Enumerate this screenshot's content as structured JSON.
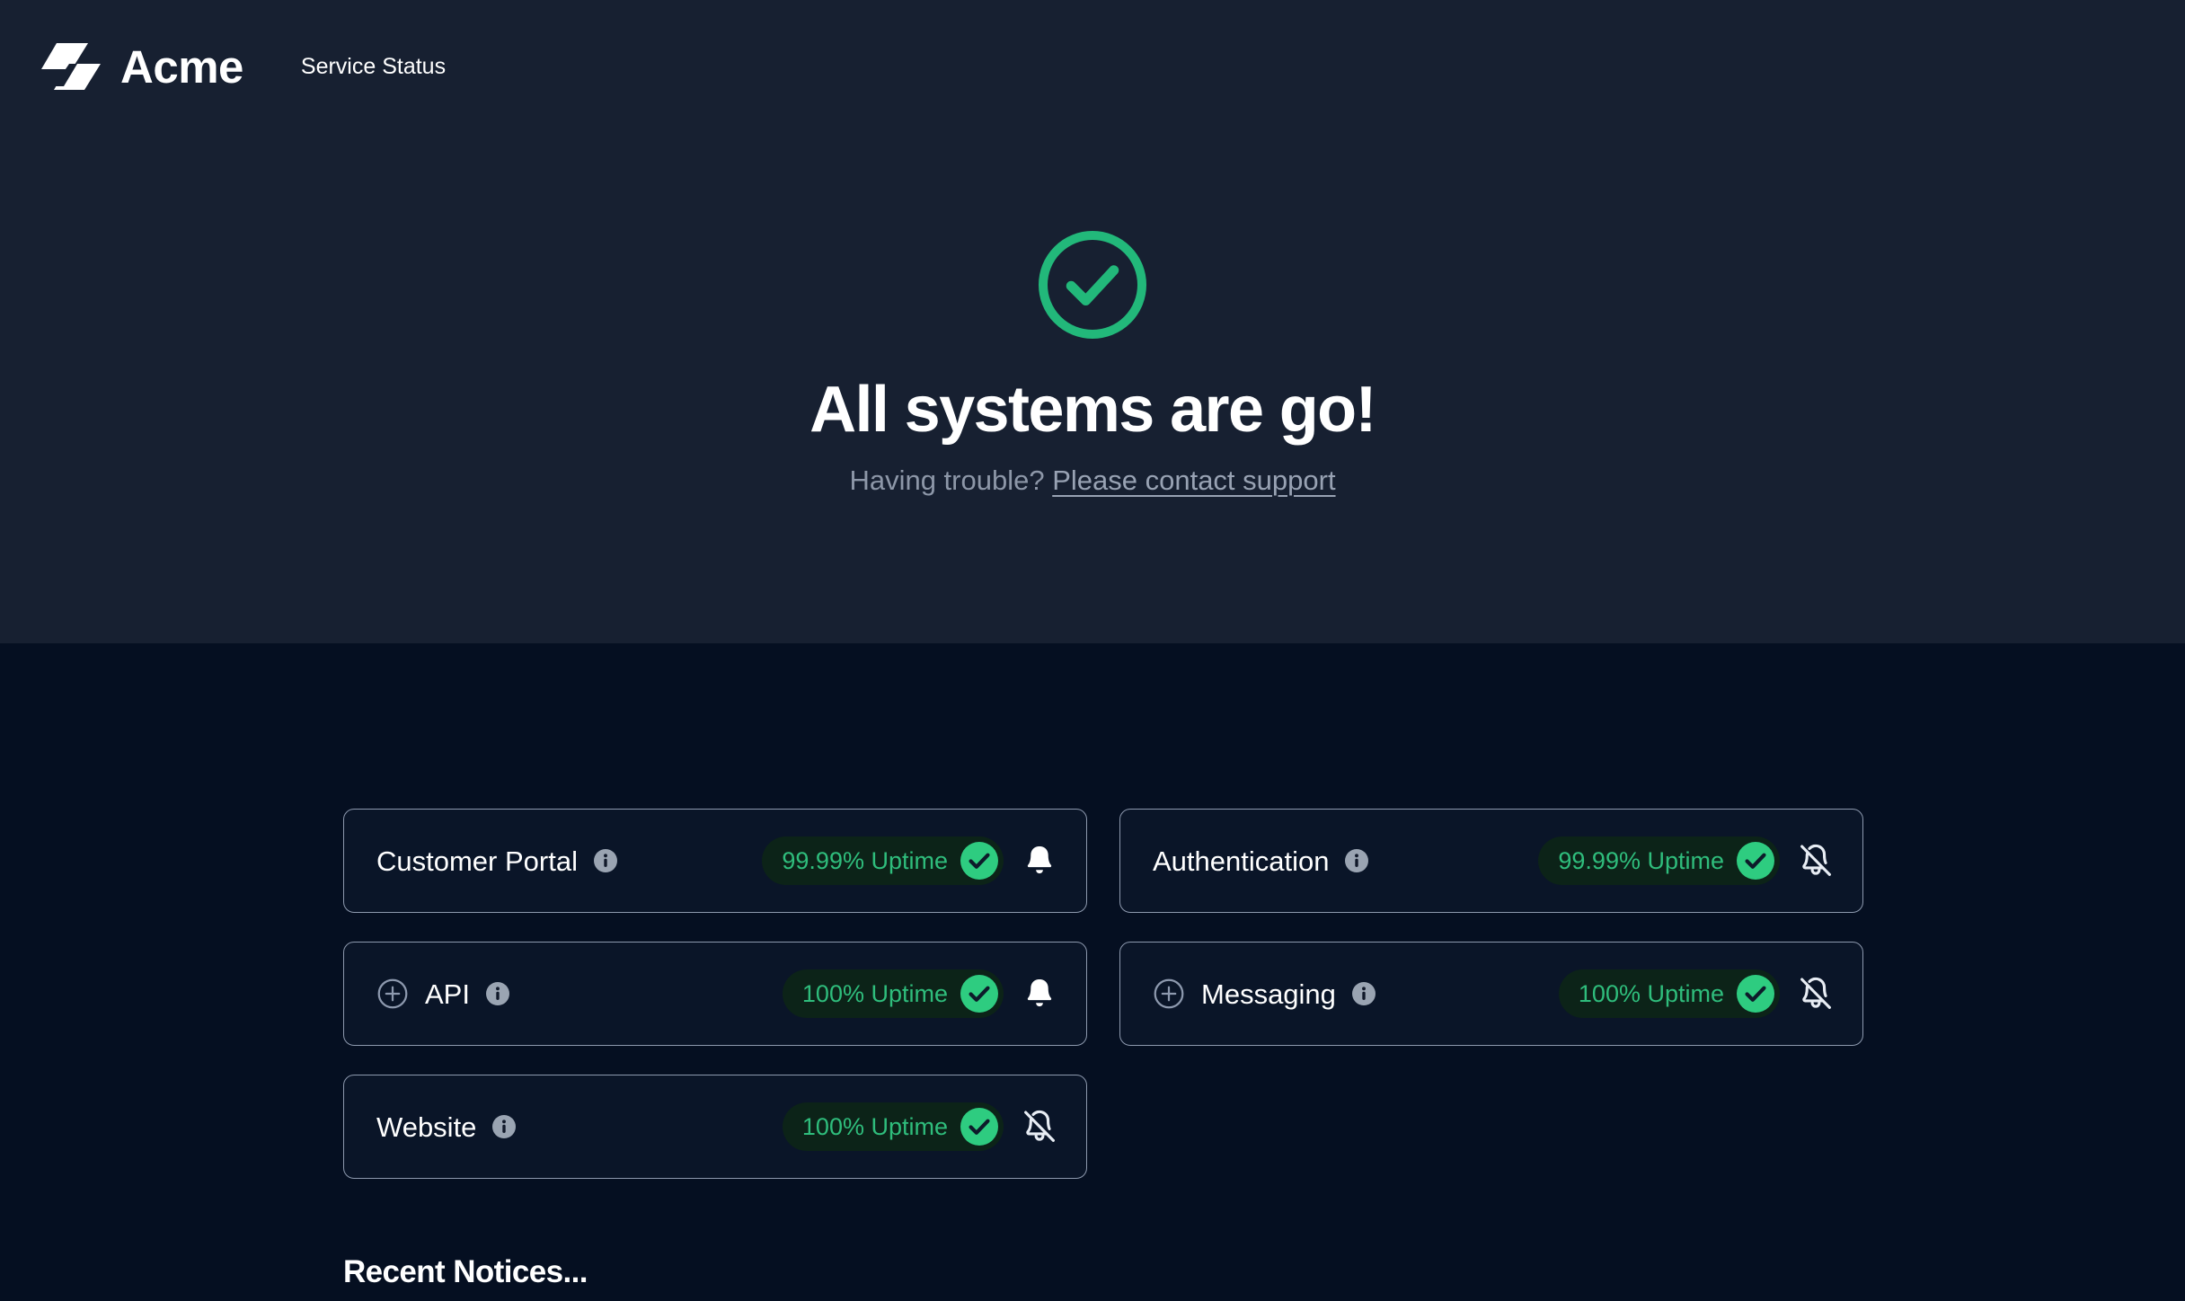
{
  "meta": {
    "accent_green": "#2ecc80",
    "pill_bg": "#0c2318",
    "pill_text": "#2fbd7c",
    "hero_bg": "#172031",
    "page_bg": "#050f21",
    "card_border": "#8d99ae",
    "card_bg": "#0a1528"
  },
  "nav": {
    "brand": "Acme",
    "logo_icon": "acme-parallelogram-logo",
    "links": [
      {
        "label": "Service Status",
        "name": "nav-link-service-status"
      }
    ]
  },
  "hero": {
    "status_icon": "check-circle-icon",
    "title": "All systems are go!",
    "subtitle_prefix": "Having trouble?",
    "support_link": "Please contact support"
  },
  "services": {
    "info_icon": "info-icon",
    "expand_icon": "plus-circle-icon",
    "bell_on_icon": "bell-icon",
    "bell_off_icon": "bell-off-icon",
    "uptime_badge_icon": "check-badge-icon",
    "items": [
      {
        "name": "Customer Portal",
        "uptime": "99.99% Uptime",
        "expandable": false,
        "notifications": "on",
        "column": "left"
      },
      {
        "name": "Authentication",
        "uptime": "99.99% Uptime",
        "expandable": false,
        "notifications": "off",
        "column": "right"
      },
      {
        "name": "API",
        "uptime": "100% Uptime",
        "expandable": true,
        "notifications": "on",
        "column": "left"
      },
      {
        "name": "Messaging",
        "uptime": "100% Uptime",
        "expandable": true,
        "notifications": "off",
        "column": "right"
      },
      {
        "name": "Website",
        "uptime": "100% Uptime",
        "expandable": false,
        "notifications": "off",
        "column": "left"
      }
    ]
  },
  "notices": {
    "heading": "Recent Notices..."
  }
}
